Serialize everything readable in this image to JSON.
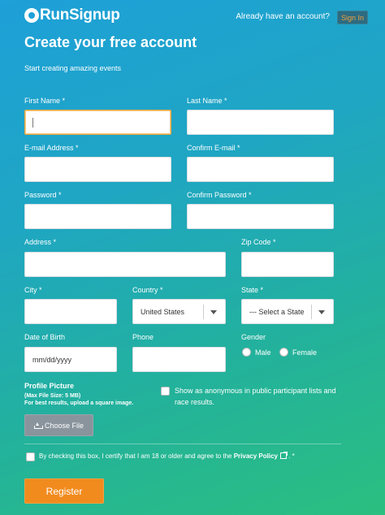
{
  "header": {
    "logo_text": "RunSignup",
    "account_prompt": "Already have an account?",
    "signin_label": "Sign In"
  },
  "page": {
    "title": "Create your free account",
    "subtitle": "Start creating amazing events"
  },
  "fields": {
    "first_name": {
      "label": "First Name *",
      "value": ""
    },
    "last_name": {
      "label": "Last Name *",
      "value": ""
    },
    "email": {
      "label": "E-mail Address *",
      "value": ""
    },
    "confirm_email": {
      "label": "Confirm E-mail *",
      "value": ""
    },
    "password": {
      "label": "Password *",
      "value": ""
    },
    "confirm_password": {
      "label": "Confirm Password *",
      "value": ""
    },
    "address": {
      "label": "Address *",
      "value": ""
    },
    "zip": {
      "label": "Zip Code *",
      "value": ""
    },
    "city": {
      "label": "City *",
      "value": ""
    },
    "country": {
      "label": "Country *",
      "selected": "United States"
    },
    "state": {
      "label": "State *",
      "selected": "--- Select a State"
    },
    "dob": {
      "label": "Date of Birth",
      "placeholder": "mm/dd/yyyy"
    },
    "phone": {
      "label": "Phone",
      "value": ""
    },
    "gender": {
      "label": "Gender",
      "options": [
        "Male",
        "Female"
      ]
    }
  },
  "profile": {
    "title": "Profile Picture",
    "max_size": "(Max File Size: 5 MB)",
    "hint": "For best results, upload a square image.",
    "choose_label": "Choose File"
  },
  "anonymous": {
    "line1": "Show as anonymous in public participant lists and",
    "line2": "race results."
  },
  "consent": {
    "text": "By checking this box, I certify that I am 18 or older and agree to the",
    "link": "Privacy Policy",
    "suffix": ". *"
  },
  "register_label": "Register"
}
